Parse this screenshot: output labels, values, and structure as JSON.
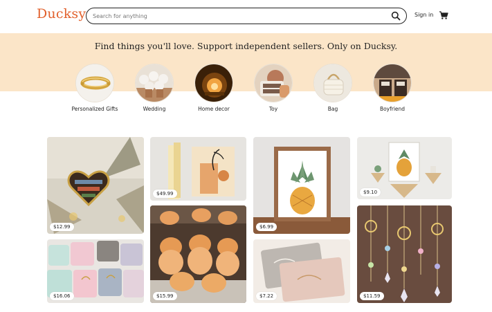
{
  "header": {
    "logo": "Ducksy",
    "search_placeholder": "Search for anything",
    "sign_in": "Sign in"
  },
  "banner": {
    "tagline": "Find things you'll love. Support independent sellers. Only on Ducksy."
  },
  "categories": [
    {
      "label": "Personalized Gifts"
    },
    {
      "label": "Wedding"
    },
    {
      "label": "Home decor"
    },
    {
      "label": "Toy"
    },
    {
      "label": "Bag"
    },
    {
      "label": "Boyfriend"
    }
  ],
  "products": [
    {
      "price": "$12.99"
    },
    {
      "price": "$49.99"
    },
    {
      "price": "$6.99"
    },
    {
      "price": "$9.10"
    },
    {
      "price": "$16.06"
    },
    {
      "price": "$15.99"
    },
    {
      "price": "$7.22"
    },
    {
      "price": "$11.59"
    }
  ],
  "icons": {
    "search": "search-icon",
    "cart": "cart-icon"
  }
}
